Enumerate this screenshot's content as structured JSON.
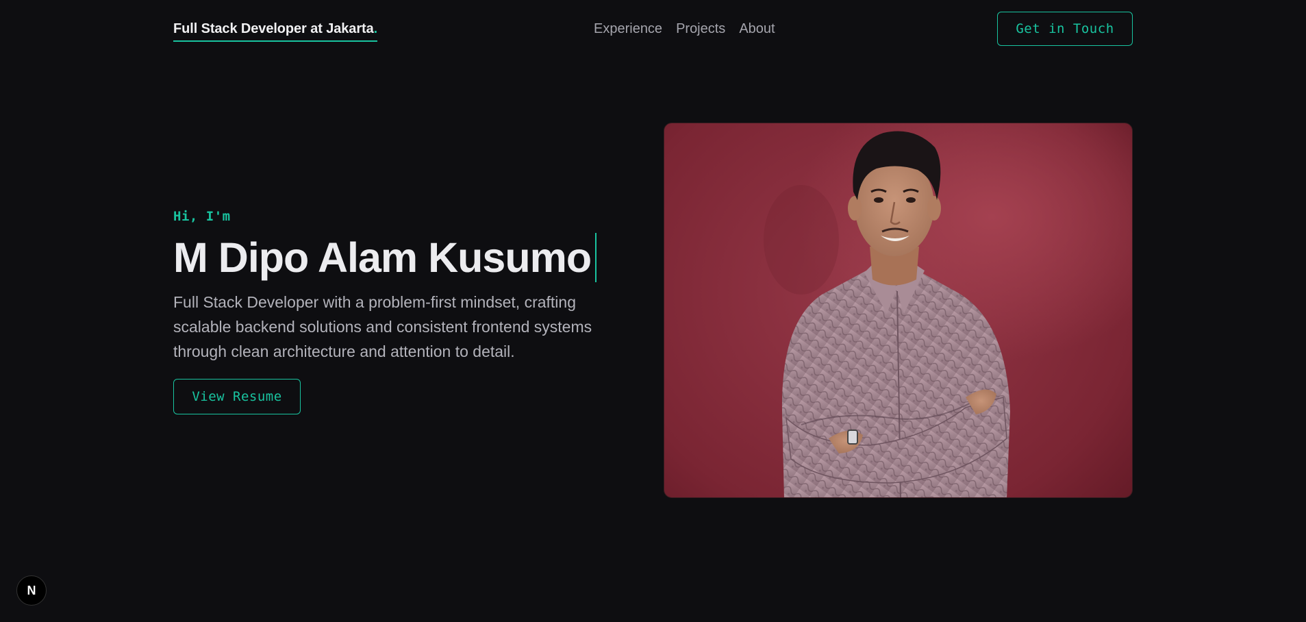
{
  "nav": {
    "brand": "Full Stack Developer at Jakarta",
    "brand_dot": ".",
    "links": [
      "Experience",
      "Projects",
      "About"
    ],
    "cta": "Get in Touch"
  },
  "hero": {
    "greeting": "Hi, I'm",
    "name": "M Dipo Alam Kusumo",
    "description": "Full Stack Developer with a problem-first mindset, crafting scalable backend solutions and consistent frontend systems through clean architecture and attention to detail.",
    "resume_button": "View Resume"
  },
  "badge": {
    "letter": "N"
  },
  "colors": {
    "background": "#0e0e11",
    "accent": "#19c4a0",
    "photo_background": "#8a2e3e"
  }
}
